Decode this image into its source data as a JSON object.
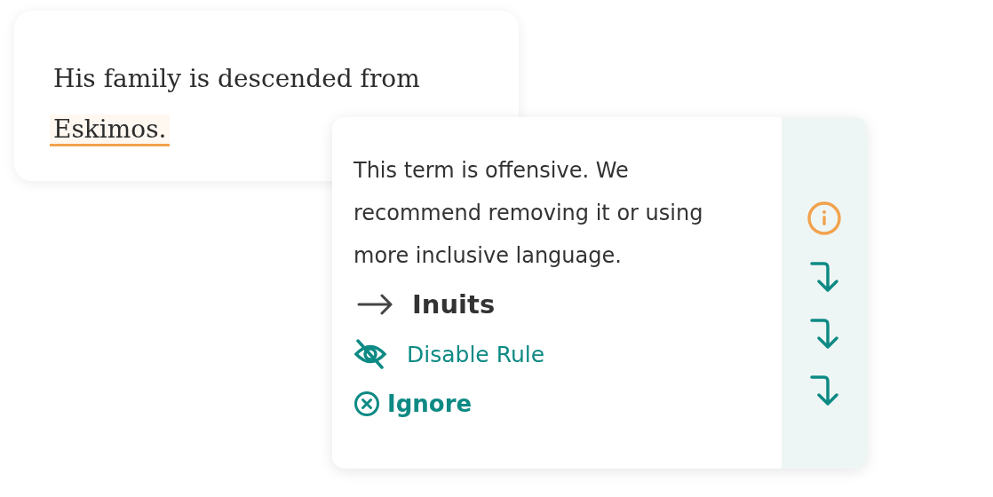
{
  "editor": {
    "text": "His family is descended from",
    "flagged_term": "Eskimos."
  },
  "suggestion": {
    "message": "This term is offensive. We recommend removing it or using more inclusive language.",
    "replacement": "Inuits",
    "actions": [
      {
        "kind": "disable",
        "label": "Disable Rule"
      },
      {
        "kind": "ignore",
        "label": "Ignore"
      }
    ]
  },
  "side_rail": [
    {
      "kind": "info"
    },
    {
      "kind": "jump"
    },
    {
      "kind": "jump"
    },
    {
      "kind": "jump"
    }
  ]
}
